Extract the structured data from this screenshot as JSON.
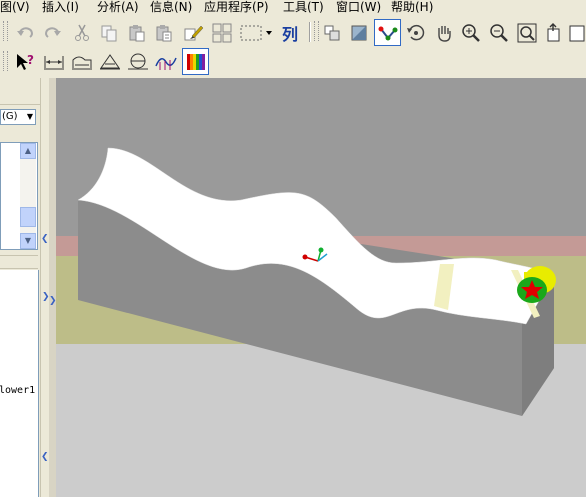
{
  "menubar": {
    "items": [
      {
        "label": "图(V)"
      },
      {
        "label": "插入(I)"
      },
      {
        "label": "分析(A)"
      },
      {
        "label": "信息(N)"
      },
      {
        "label": "应用程序(P)"
      },
      {
        "label": "工具(T)"
      },
      {
        "label": "窗口(W)"
      },
      {
        "label": "帮助(H)"
      }
    ]
  },
  "toolbar": {
    "array_label": "列"
  },
  "left_panel": {
    "dropdown_value": "(G)",
    "tree_label": "lower1"
  },
  "colors": {
    "chrome": "#ece9d8",
    "background": "#9a9a9a",
    "floor": "#cccccc",
    "base_block": "#8c8c8c",
    "wave_surface": "#ffffff",
    "pink_band": "#c49a96",
    "olive_band": "#bdbd88",
    "cylinder": "#e8ec00",
    "cylinder_face": "#1aa81a",
    "star": "#e00000",
    "accent": "#316ac5"
  }
}
